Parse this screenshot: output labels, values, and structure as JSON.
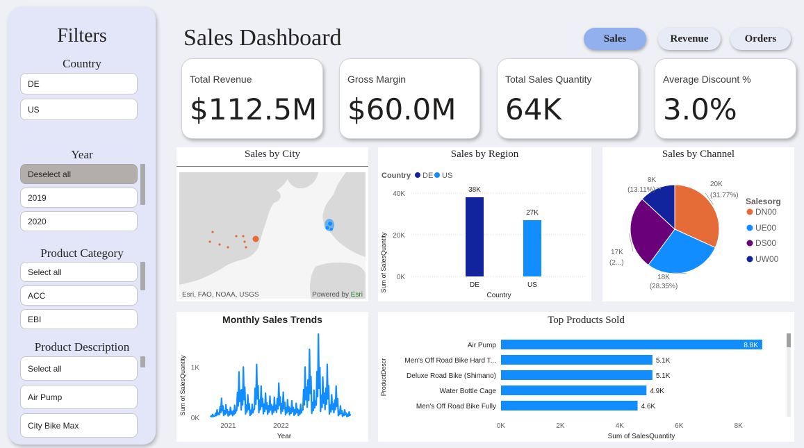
{
  "sidebar": {
    "title": "Filters",
    "country": {
      "label": "Country",
      "items": [
        "DE",
        "US"
      ]
    },
    "year": {
      "label": "Year",
      "items": [
        "Deselect all",
        "2019",
        "2020"
      ]
    },
    "category": {
      "label": "Product Category",
      "items": [
        "Select all",
        "ACC",
        "EBI"
      ]
    },
    "description": {
      "label": "Product Description",
      "items": [
        "Select all",
        "Air Pump",
        "City Bike Max"
      ]
    }
  },
  "header": {
    "title": "Sales Dashboard",
    "tabs": [
      "Sales",
      "Revenue",
      "Orders"
    ],
    "active_tab": "Sales"
  },
  "kpis": [
    {
      "label": "Total Revenue",
      "value": "$112.5M"
    },
    {
      "label": "Gross Margin",
      "value": "$60.0M"
    },
    {
      "label": "Total Sales Quantity",
      "value": "64K"
    },
    {
      "label": "Average Discount %",
      "value": "3.0%"
    }
  ],
  "map": {
    "title": "Sales by City",
    "attribution": "Esri, FAO, NOAA, USGS",
    "powered_by": "Powered by",
    "powered_brand": "Esri"
  },
  "colors": {
    "de": "#12239e",
    "us": "#118dff",
    "dn00": "#e66c37",
    "ue00": "#118dff",
    "ds00": "#6b007b",
    "uw00": "#12239e",
    "active_tab": "#93b0ee"
  },
  "chart_data": [
    {
      "type": "bar",
      "title": "Sales by Region",
      "legend_title": "Country",
      "categories": [
        "DE",
        "US"
      ],
      "values": [
        38000,
        27000
      ],
      "data_labels": [
        "38K",
        "27K"
      ],
      "series": [
        {
          "name": "DE",
          "values": [
            38000,
            null
          ]
        },
        {
          "name": "US",
          "values": [
            null,
            27000
          ]
        }
      ],
      "xlabel": "Country",
      "ylabel": "Sum of SalesQuantity",
      "yticks": [
        "0K",
        "20K",
        "40K"
      ],
      "ylim": [
        0,
        45000
      ],
      "grid": true,
      "legend": "top-left"
    },
    {
      "type": "pie",
      "title": "Sales by Channel",
      "legend_title": "Salesorg",
      "slices": [
        {
          "name": "DN00",
          "value": 20000,
          "percent": 31.77,
          "label": "20K",
          "pct_label": "(31.77%)"
        },
        {
          "name": "UE00",
          "value": 18000,
          "percent": 28.35,
          "label": "18K",
          "pct_label": "(28.35%)"
        },
        {
          "name": "DS00",
          "value": 17000,
          "percent": 26.77,
          "label": "17K",
          "pct_label": "(2...)"
        },
        {
          "name": "UW00",
          "value": 8000,
          "percent": 13.11,
          "label": "8K",
          "pct_label": "(13.11%)"
        }
      ],
      "legend": "right"
    },
    {
      "type": "line",
      "title": "Monthly Sales Trends",
      "xlabel": "Year",
      "ylabel": "Sum of SalesQuantity",
      "xticks": [
        "2021",
        "2022"
      ],
      "yticks": [
        "0K",
        "1K"
      ],
      "ylim": [
        0,
        1650
      ],
      "x_start": "2020-07-01",
      "x_end": "2023-06-30",
      "x": [
        "2020-09",
        "2020-10",
        "2020-11",
        "2020-12",
        "2021-01",
        "2021-02",
        "2021-03",
        "2021-04",
        "2021-05",
        "2021-06",
        "2021-07",
        "2021-08",
        "2021-09",
        "2021-10",
        "2021-11",
        "2021-12",
        "2022-01",
        "2022-02",
        "2022-03",
        "2022-04",
        "2022-05",
        "2022-06",
        "2022-07",
        "2022-08",
        "2022-09",
        "2022-10",
        "2022-11",
        "2022-12",
        "2023-01",
        "2023-02",
        "2023-03",
        "2023-04"
      ],
      "y": [
        60,
        150,
        380,
        250,
        200,
        240,
        900,
        1000,
        450,
        260,
        1050,
        620,
        480,
        420,
        400,
        680,
        500,
        350,
        330,
        280,
        260,
        1000,
        1350,
        540,
        1650,
        800,
        1050,
        450,
        620,
        230,
        150,
        110
      ],
      "grid": false
    },
    {
      "type": "bar",
      "orientation": "horizontal",
      "title": "Top Products Sold",
      "categories": [
        "Air Pump",
        "Men's Off Road Bike Hard T...",
        "Deluxe Road Bike (Shimano)",
        "Water Bottle Cage",
        "Men's Off Road Bike Fully"
      ],
      "values": [
        8800,
        5100,
        5100,
        4900,
        4600
      ],
      "data_labels": [
        "8.8K",
        "5.1K",
        "5.1K",
        "4.9K",
        "4.6K"
      ],
      "xlabel": "Sum of SalesQuantity",
      "ylabel": "ProductDescr",
      "xticks": [
        "0K",
        "2K",
        "4K",
        "6K",
        "8K"
      ],
      "xlim": [
        0,
        9200
      ],
      "grid": false
    }
  ]
}
